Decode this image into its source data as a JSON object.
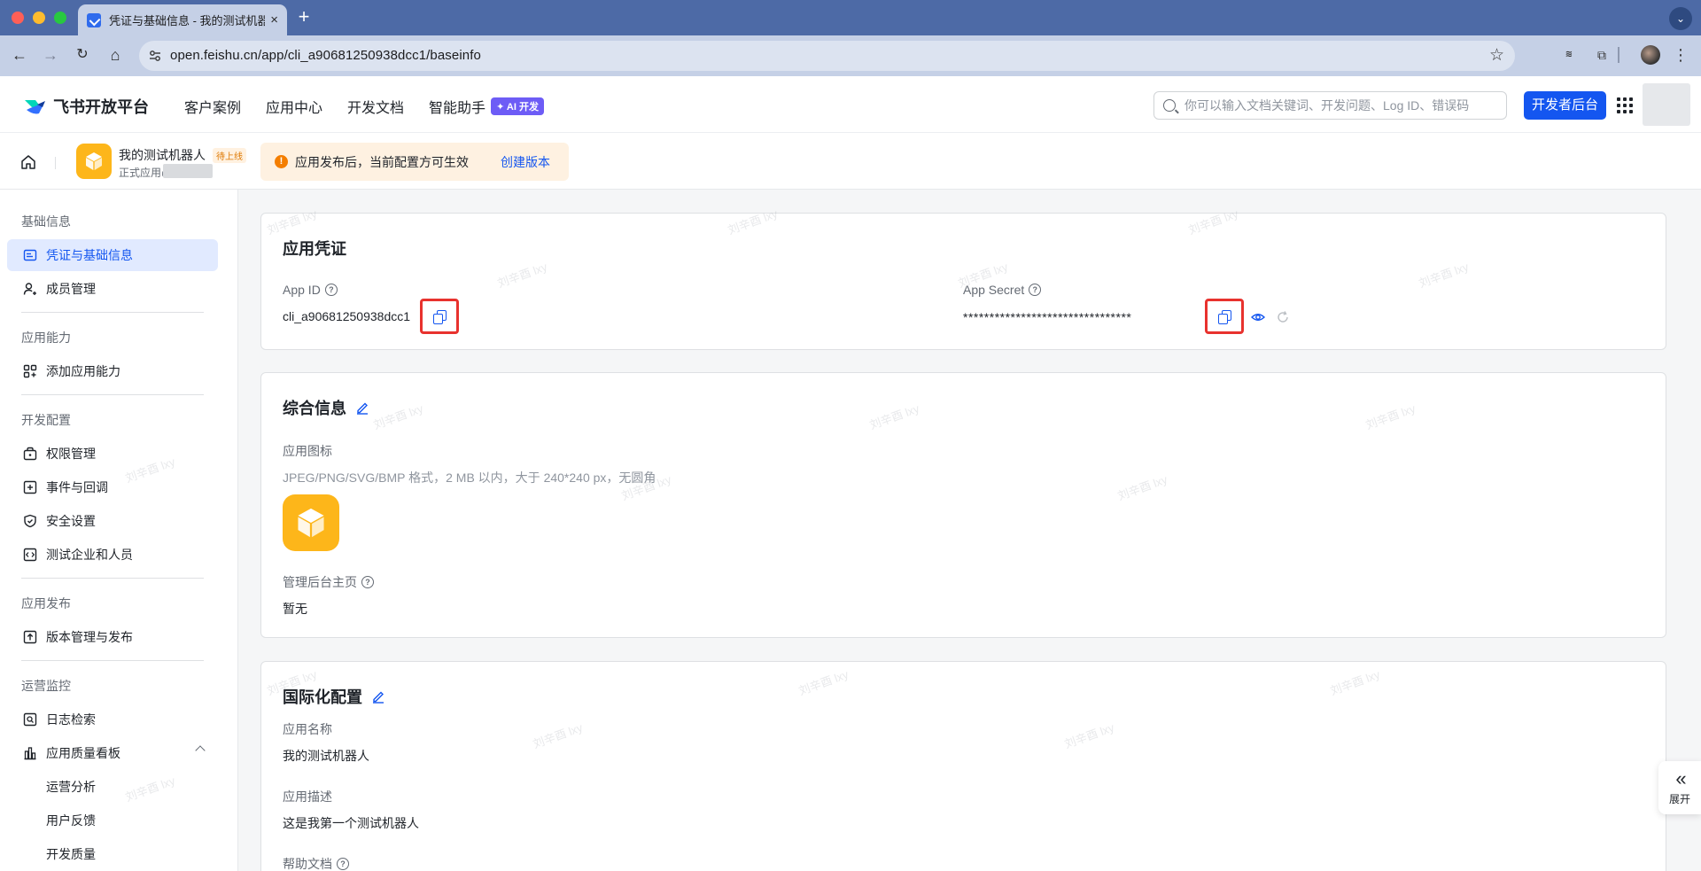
{
  "browser": {
    "tab_title": "凭证与基础信息 - 我的测试机器人",
    "url": "open.feishu.cn/app/cli_a90681250938dcc1/baseinfo",
    "new_tab": "+",
    "close": "×",
    "dropdown": "⌄"
  },
  "header": {
    "logo_text": "飞书开放平台",
    "nav": [
      "客户案例",
      "应用中心",
      "开发文档",
      "智能助手"
    ],
    "ai_badge": "✦ AI 开发",
    "search_placeholder": "你可以输入文档关键词、开发问题、Log ID、错误码",
    "dev_console": "开发者后台"
  },
  "subheader": {
    "app_name": "我的测试机器人",
    "app_status": "待上线",
    "app_sub": "正式应用@",
    "notice": "应用发布后，当前配置方可生效",
    "notice_link": "创建版本"
  },
  "sidebar": {
    "groups": {
      "basic": "基础信息",
      "ability": "应用能力",
      "dev": "开发配置",
      "publish": "应用发布",
      "ops": "运营监控"
    },
    "items": {
      "credentials": "凭证与基础信息",
      "members": "成员管理",
      "add_ability": "添加应用能力",
      "permissions": "权限管理",
      "events": "事件与回调",
      "security": "安全设置",
      "test_org": "测试企业和人员",
      "versions": "版本管理与发布",
      "log_search": "日志检索",
      "quality": "应用质量看板",
      "ops_analysis": "运营分析",
      "feedback": "用户反馈",
      "dev_quality": "开发质量"
    }
  },
  "credentials_card": {
    "title": "应用凭证",
    "app_id_label": "App ID",
    "app_id": "cli_a90681250938dcc1",
    "app_secret_label": "App Secret",
    "app_secret": "********************************"
  },
  "general_card": {
    "title": "综合信息",
    "icon_label": "应用图标",
    "icon_hint": "JPEG/PNG/SVG/BMP 格式，2 MB 以内，大于 240*240 px，无圆角",
    "homepage_label": "管理后台主页",
    "homepage_value": "暂无"
  },
  "i18n_card": {
    "title": "国际化配置",
    "name_label": "应用名称",
    "name_value": "我的测试机器人",
    "desc_label": "应用描述",
    "desc_value": "这是我第一个测试机器人",
    "help_label": "帮助文档"
  },
  "expand": {
    "label": "展开",
    "arrows": "«"
  },
  "watermark": "刘辛酉 lxy",
  "colors": {
    "primary": "#1456f0",
    "accent_orange": "#fdb61a",
    "highlight_red": "#e8322e"
  }
}
